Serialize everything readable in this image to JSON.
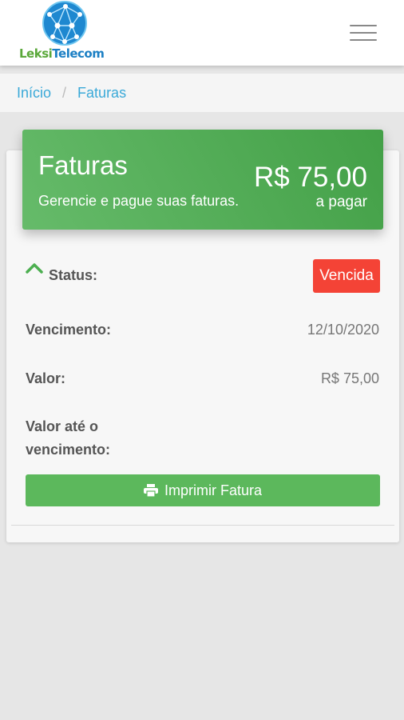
{
  "brand": {
    "part1": "Leksi",
    "part2": "Telecom"
  },
  "topbar": {
    "menu_icon": "hamburger-menu-icon"
  },
  "breadcrumb": {
    "home": "Início",
    "separator": "/",
    "current": "Faturas"
  },
  "invoice_header": {
    "title": "Faturas",
    "subtitle": "Gerencie e pague suas faturas.",
    "amount": "R$ 75,00",
    "amount_label": "a pagar",
    "color": "#4caf50"
  },
  "invoice": {
    "status_label": "Status:",
    "status_value": "Vencida",
    "status_color": "#f44336",
    "due_label": "Vencimento:",
    "due_value": "12/10/2020",
    "amount_label": "Valor:",
    "amount_value": "R$ 75,00",
    "until_due_label_line1": "Valor até o",
    "until_due_label_line2": "vencimento:",
    "until_due_value": ""
  },
  "print_button": {
    "label": "Imprimir Fatura",
    "icon": "printer-icon"
  }
}
